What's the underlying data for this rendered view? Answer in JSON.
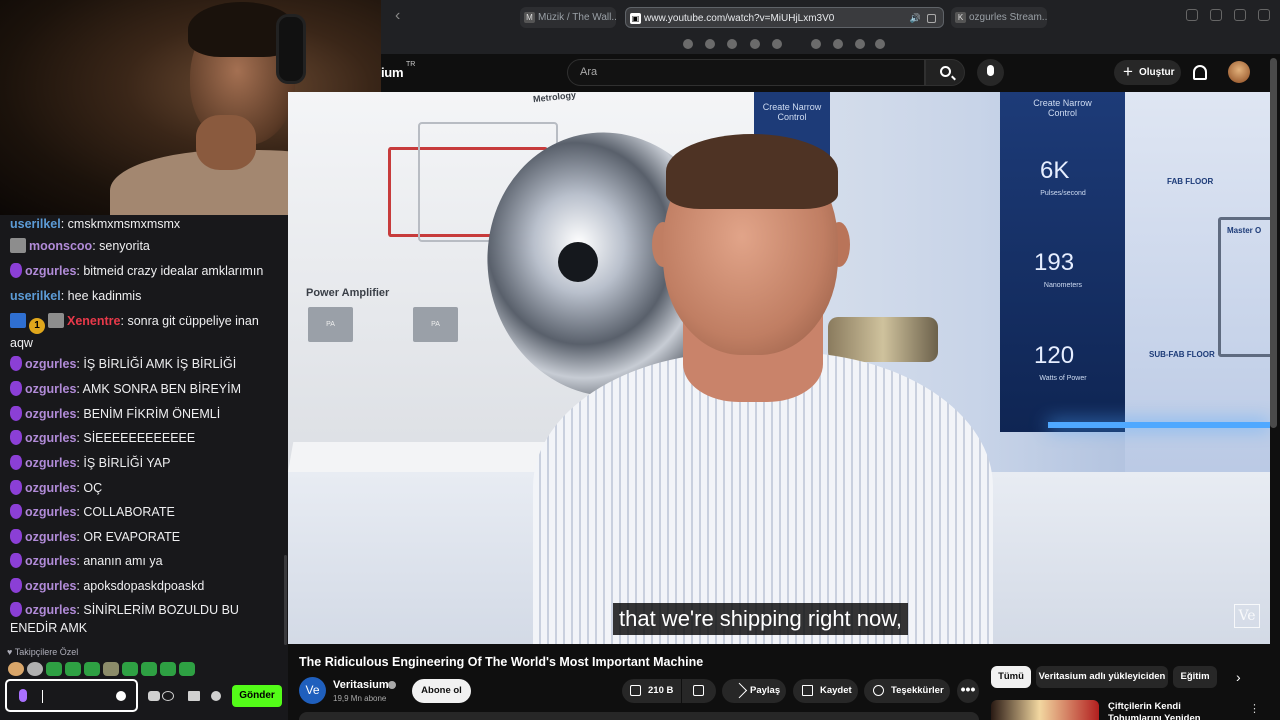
{
  "browser": {
    "tabs": [
      {
        "label": "Müzik / The Wall...",
        "favicon": "M"
      },
      {
        "label": "www.youtube.com/watch?v=MiUHjLxm3V0",
        "favicon": "▣"
      },
      {
        "label": "ozgurles Stream...",
        "favicon": "K"
      }
    ]
  },
  "chat": {
    "messages": [
      {
        "user": "userilkel",
        "text": ": cmskmxmsmxmsmx",
        "color": "blue",
        "badges": []
      },
      {
        "user": "moonscoo",
        "text": ": senyorita",
        "color": "purple",
        "badges": [
          "img"
        ]
      },
      {
        "user": "ozgurles",
        "text": ": bitmeid crazy idealar amklarımın",
        "color": "purple",
        "badges": [
          "mic"
        ]
      },
      {
        "user": "userilkel",
        "text": ": hee kadinmis",
        "color": "blue",
        "badges": []
      },
      {
        "user": "Xenentre",
        "text": ": sonra git cüppeliye inan aqw",
        "color": "red",
        "badges": [
          "tool",
          "gold",
          "img"
        ]
      },
      {
        "user": "ozgurles",
        "text": ": İŞ BİRLİĞİ AMK İŞ BİRLİĞİ",
        "color": "purple",
        "badges": [
          "mic"
        ]
      },
      {
        "user": "ozgurles",
        "text": ": AMK SONRA BEN BİREYİM",
        "color": "purple",
        "badges": [
          "mic"
        ]
      },
      {
        "user": "ozgurles",
        "text": ": BENİM FİKRİM ÖNEMLİ",
        "color": "purple",
        "badges": [
          "mic"
        ]
      },
      {
        "user": "ozgurles",
        "text": ": SİEEEEEEEEEEEE",
        "color": "purple",
        "badges": [
          "mic"
        ]
      },
      {
        "user": "ozgurles",
        "text": ": İŞ BİRLİĞİ YAP",
        "color": "purple",
        "badges": [
          "mic"
        ]
      },
      {
        "user": "ozgurles",
        "text": ": OÇ",
        "color": "purple",
        "badges": [
          "mic"
        ]
      },
      {
        "user": "ozgurles",
        "text": ": COLLABORATE",
        "color": "purple",
        "badges": [
          "mic"
        ]
      },
      {
        "user": "ozgurles",
        "text": ": OR EVAPORATE",
        "color": "purple",
        "badges": [
          "mic"
        ]
      },
      {
        "user": "ozgurles",
        "text": ": ananın amı ya",
        "color": "purple",
        "badges": [
          "mic"
        ]
      },
      {
        "user": "ozgurles",
        "text": ": apoksdopaskdpoaskd",
        "color": "purple",
        "badges": [
          "mic"
        ]
      },
      {
        "user": "ozgurles",
        "text": ": SİNİRLERİM BOZULDU BU ENEDİR AMK",
        "color": "purple",
        "badges": [
          "mic"
        ]
      }
    ],
    "badge_one": "1",
    "followers_label": "Takipçilere Özel",
    "send_label": "Gönder",
    "input_value": ""
  },
  "youtube": {
    "logo_text": "ium",
    "logo_tr": "TR",
    "search_placeholder": "Ara",
    "create_label": "Oluştur",
    "video": {
      "subtitle": "that we're shipping right now,",
      "watermark": "Ve",
      "scene": {
        "power_amplifier": "Power Amplifier",
        "metrology": "Metrology",
        "pa": "PA",
        "create_narrow_control": "Create Narrow Control",
        "stat1": "6K",
        "stat1_label": "Pulses/second",
        "stat2": "193",
        "stat2_label": "Nanometers",
        "stat3": "120",
        "stat3_label": "Watts of Power",
        "fab_floor": "FAB FLOOR",
        "subfab_floor": "SUB-FAB FLOOR",
        "master": "Master O"
      }
    },
    "title": "The Ridiculous Engineering Of The World's Most Important Machine",
    "channel": {
      "name": "Veritasium",
      "subs": "19,9 Mn abone",
      "avatar_text": "Ve"
    },
    "subscribe_label": "Abone ol",
    "actions": {
      "like": "210 B",
      "share": "Paylaş",
      "save": "Kaydet",
      "thanks": "Teşekkürler",
      "more": "•••"
    },
    "chips": [
      "Tümü",
      "Veritasium adlı yükleyiciden",
      "Eğitim"
    ],
    "recommended": {
      "title": "Çiftçilerin Kendi Tohumlarını Yeniden Ekmelerinin Neden"
    }
  }
}
